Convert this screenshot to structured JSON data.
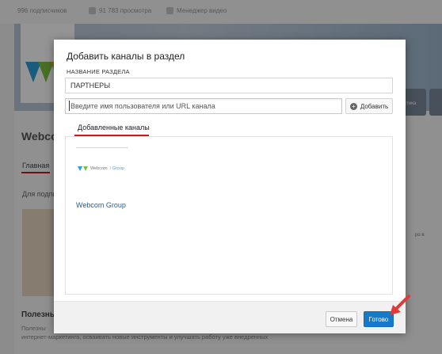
{
  "background": {
    "stats": [
      "996 подписчиков",
      "91 783 просмотра",
      "Менеджер видео"
    ],
    "channel_title": "Webco",
    "nav_tab": "Главная",
    "for_label": "Для подпи",
    "section_title": "Полезны",
    "section_desc": "Полезны",
    "section_desc_line": "интернет-маркетинга, осваивать новые инструменты и улучшать работу уже внедренных",
    "right_small_1": "стика",
    "right_small_2": "ро в"
  },
  "dialog": {
    "title": "Добавить каналы в раздел",
    "name_label": "НАЗВАНИЕ РАЗДЕЛА",
    "name_value": "ПАРТНЕРЫ",
    "channel_placeholder": "Введите имя пользователя или URL канала",
    "add_button": "Добавить",
    "tab_added": "Добавленные каналы",
    "channel_thumb_text": "Webcom",
    "channel_thumb_suffix": "/ Group",
    "channel_name": "Webcom Group",
    "cancel_button": "Отмена",
    "done_button": "Готово"
  },
  "colors": {
    "primary": "#167ac6",
    "accent_red": "#cc181e",
    "link": "#1f5fa3"
  },
  "icons": [
    "views-icon",
    "video-manager-icon",
    "plus-icon",
    "red-arrow-icon"
  ]
}
